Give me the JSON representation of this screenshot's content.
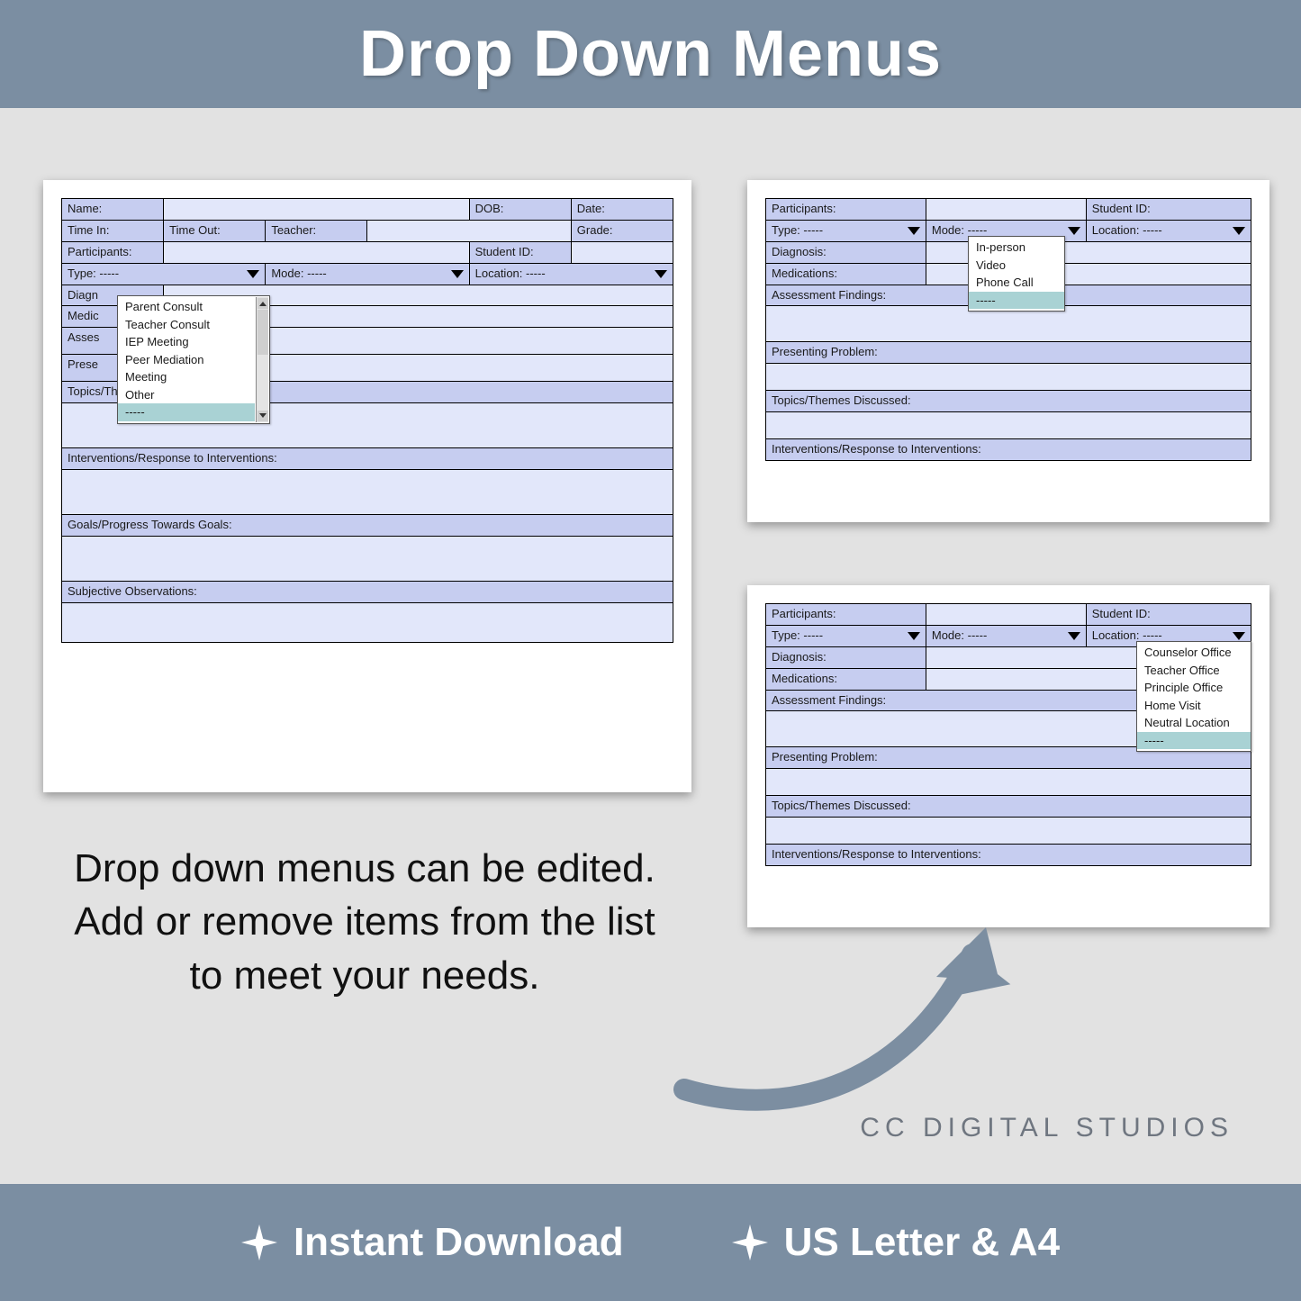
{
  "title": "Drop Down Menus",
  "caption": "Drop down menus can be edited.  Add or remove items from the list to meet your needs.",
  "brand": "CC DIGITAL STUDIOS",
  "footer": {
    "instant": "Instant Download",
    "paper": "US Letter & A4"
  },
  "dash": "-----",
  "form": {
    "name": "Name:",
    "dob": "DOB:",
    "date": "Date:",
    "time_in": "Time In:",
    "time_out": "Time Out:",
    "teacher": "Teacher:",
    "grade": "Grade:",
    "participants": "Participants:",
    "student_id": "Student ID:",
    "type": "Type:",
    "mode": "Mode:",
    "location": "Location:",
    "diagnosis": "Diagnosis:",
    "diagn_short": "Diagn",
    "medications": "Medications:",
    "medic_short": "Medic",
    "assessment_findings": "Assessment Findings:",
    "asses_short": "Asses",
    "presenting_problem": "Presenting Problem:",
    "prese_short": "Prese",
    "topics": "Topics/Themes Discussed:",
    "interventions": "Interventions/Response to Interventions:",
    "goals": "Goals/Progress Towards Goals:",
    "subjective": "Subjective Observations:"
  },
  "type_options": [
    "Parent Consult",
    "Teacher Consult",
    "IEP Meeting",
    "Peer Mediation",
    "Meeting",
    "Other",
    "-----"
  ],
  "mode_options": [
    "In-person",
    "Video",
    "Phone Call",
    "-----"
  ],
  "location_options": [
    "Counselor Office",
    "Teacher Office",
    "Principle Office",
    "Home Visit",
    "Neutral Location",
    "-----"
  ]
}
